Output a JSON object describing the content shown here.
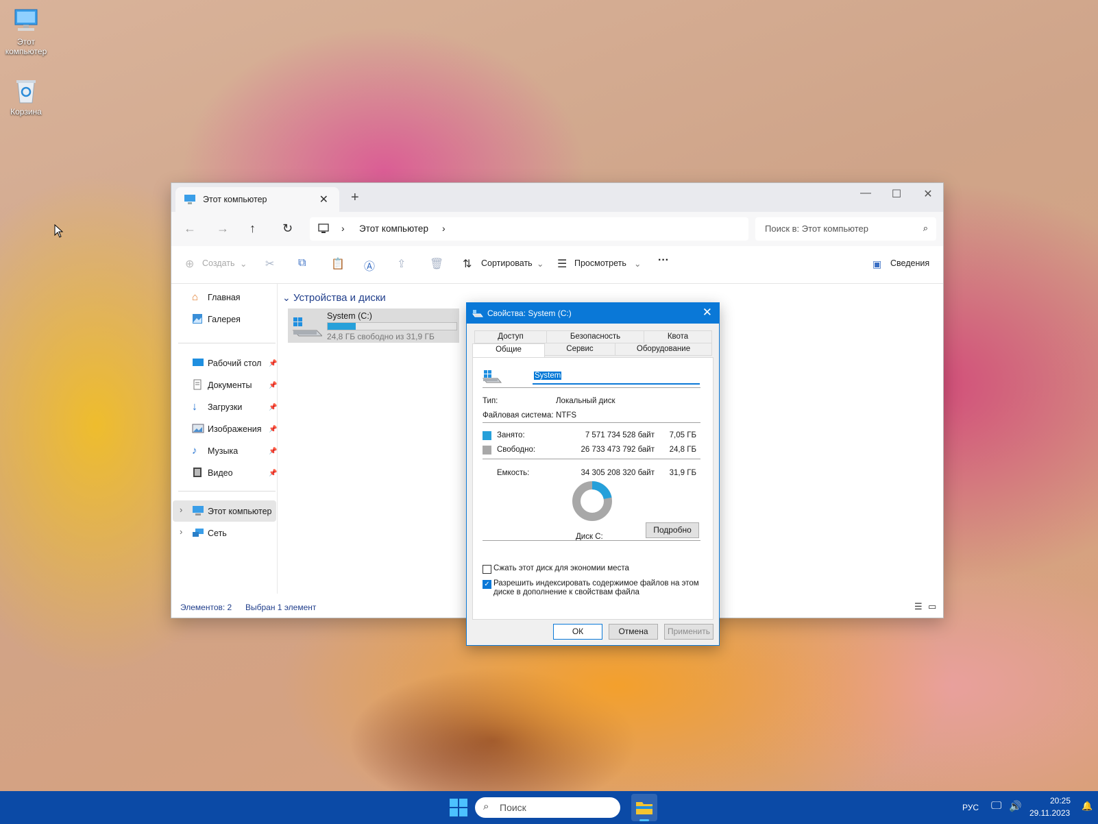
{
  "desktop": {
    "icons": [
      {
        "label_line1": "Этот",
        "label_line2": "компьютер"
      },
      {
        "label_line1": "Корзина",
        "label_line2": ""
      }
    ]
  },
  "explorer": {
    "tab_title": "Этот компьютер",
    "address_crumb": "Этот компьютер",
    "search_placeholder": "Поиск в: Этот компьютер",
    "toolbar": {
      "create": "Создать",
      "sort": "Сортировать",
      "view": "Просмотреть",
      "more": "···",
      "details": "Сведения"
    },
    "sidebar": {
      "home": "Главная",
      "gallery": "Галерея",
      "pinned": [
        "Рабочий стол",
        "Документы",
        "Загрузки",
        "Изображения",
        "Музыка",
        "Видео"
      ],
      "this_pc": "Этот компьютер",
      "network": "Сеть"
    },
    "group_title": "Устройства и диски",
    "drive": {
      "name": "System (C:)",
      "free_text": "24,8 ГБ свободно из 31,9 ГБ",
      "used_fraction": 0.22
    },
    "status": {
      "count": "Элементов: 2",
      "selected": "Выбран 1 элемент"
    }
  },
  "properties": {
    "title": "Свойства: System (C:)",
    "tabs_row1": [
      "Доступ",
      "Безопасность",
      "Квота"
    ],
    "tabs_row2": [
      "Общие",
      "Сервис",
      "Оборудование"
    ],
    "name_value": "System",
    "type_label": "Тип:",
    "type_value": "Локальный диск",
    "fs_label": "Файловая система:",
    "fs_value": "NTFS",
    "used_label": "Занято:",
    "used_bytes": "7 571 734 528 байт",
    "used_gb": "7,05 ГБ",
    "free_label": "Свободно:",
    "free_bytes": "26 733 473 792 байт",
    "free_gb": "24,8 ГБ",
    "capacity_label": "Емкость:",
    "capacity_bytes": "34 305 208 320 байт",
    "capacity_gb": "31,9 ГБ",
    "disk_label": "Диск C:",
    "details_button": "Подробно",
    "compress_label": "Сжать этот диск для экономии места",
    "compress_checked": false,
    "index_label_line1": "Разрешить индексировать содержимое файлов на этом",
    "index_label_line2": "диске в дополнение к свойствам файла",
    "index_checked": true,
    "ok": "ОК",
    "cancel": "Отмена",
    "apply": "Применить",
    "colors": {
      "used": "#26a0da",
      "free": "#a8a8a8"
    },
    "used_fraction": 0.2207
  },
  "taskbar": {
    "search_placeholder": "Поиск",
    "lang": "РУС",
    "time": "20:25",
    "date": "29.11.2023"
  }
}
